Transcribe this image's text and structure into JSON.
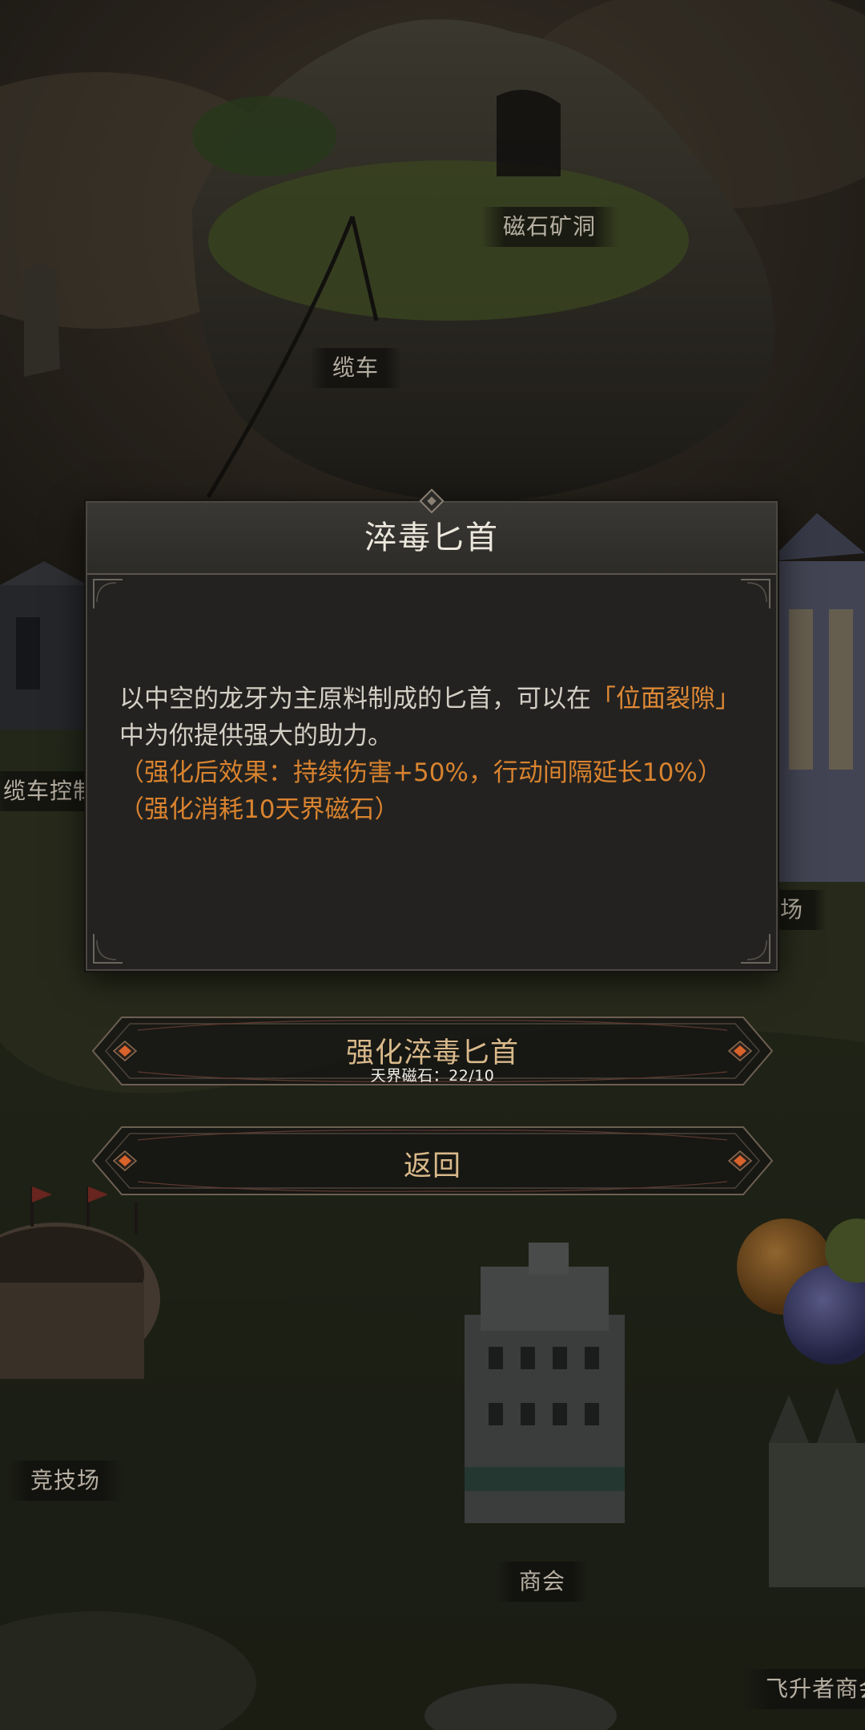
{
  "map": {
    "labels": {
      "magnet_cave": "磁石矿洞",
      "cable_car": "缆车",
      "cable_control": "缆车控制",
      "arena_right": "场",
      "arena": "竞技场",
      "guild": "商会",
      "ascender_shop": "飞升者商会"
    }
  },
  "dialog": {
    "title": "淬毒匕首",
    "desc_part1": "以中空的龙牙为主原料制成的匕首，可以在",
    "desc_highlight": "「位面裂隙」",
    "desc_part2": "中为你提供强大的助力。",
    "effect": "（强化后效果：持续伤害+50%，行动间隔延长10%）",
    "cost": "（强化消耗10天界磁石）"
  },
  "buttons": {
    "enhance_label": "强化淬毒匕首",
    "enhance_sub": "天界磁石：22/10",
    "back_label": "返回"
  },
  "colors": {
    "highlight": "#e08a36",
    "button_text": "#d9b98a",
    "gem": "#d9632b"
  }
}
